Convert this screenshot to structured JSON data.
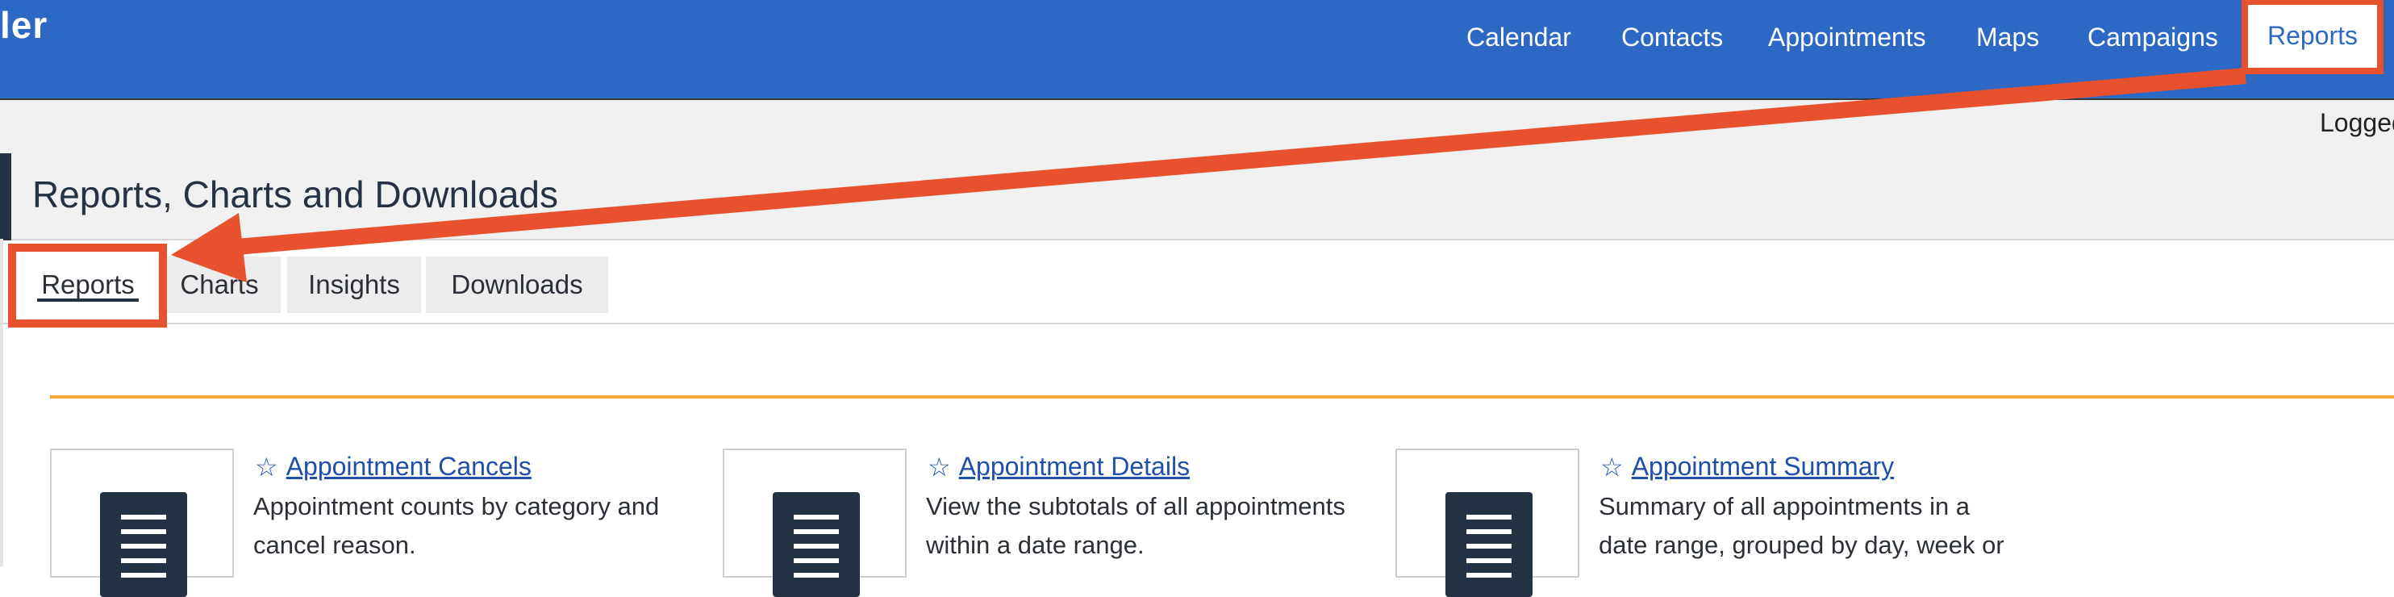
{
  "brand": {
    "text": "ler"
  },
  "nav": {
    "items": [
      {
        "label": "Calendar"
      },
      {
        "label": "Contacts"
      },
      {
        "label": "Appointments"
      },
      {
        "label": "Maps"
      },
      {
        "label": "Campaigns"
      },
      {
        "label": "Reports",
        "active": true
      }
    ]
  },
  "login": {
    "text": "Logged"
  },
  "page": {
    "title": "Reports, Charts and Downloads"
  },
  "tabs": [
    {
      "label": "Reports",
      "active": true
    },
    {
      "label": "Charts"
    },
    {
      "label": "Insights"
    },
    {
      "label": "Downloads"
    }
  ],
  "reports": [
    {
      "title": "Appointment Cancels",
      "desc_line1": "Appointment counts by category and",
      "desc_line2": "cancel reason."
    },
    {
      "title": "Appointment Details",
      "desc_line1": "View the subtotals of all appointments",
      "desc_line2": "within a date range."
    },
    {
      "title": "Appointment Summary",
      "desc_line1": "Summary of all appointments in a",
      "desc_line2": "date range, grouped by day, week or"
    }
  ],
  "icons": {
    "favorite": "star-outline-icon",
    "report": "document-icon"
  },
  "colors": {
    "topbar": "#2d68c4",
    "annotation": "#e8512d",
    "accent_rule": "#f0a830",
    "link": "#1f4fa8"
  }
}
